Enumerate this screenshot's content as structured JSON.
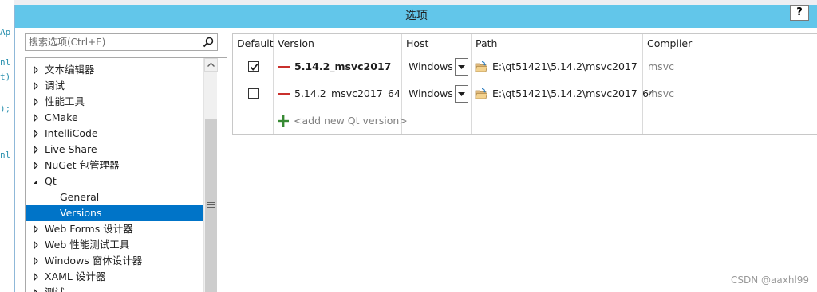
{
  "background": {
    "top_left_text": "...",
    "top_right_text": "",
    "code_fragments": [
      "Ap",
      "nl",
      "t)",
      ");",
      "nl"
    ]
  },
  "dialog": {
    "title": "选项",
    "help_label": "?"
  },
  "search": {
    "placeholder": "搜索选项(Ctrl+E)"
  },
  "tree": {
    "items": [
      {
        "label": "文本编辑器",
        "expanded": false,
        "level": 0
      },
      {
        "label": "调试",
        "expanded": false,
        "level": 0
      },
      {
        "label": "性能工具",
        "expanded": false,
        "level": 0
      },
      {
        "label": "CMake",
        "expanded": false,
        "level": 0
      },
      {
        "label": "IntelliCode",
        "expanded": false,
        "level": 0
      },
      {
        "label": "Live Share",
        "expanded": false,
        "level": 0
      },
      {
        "label": "NuGet 包管理器",
        "expanded": false,
        "level": 0
      },
      {
        "label": "Qt",
        "expanded": true,
        "level": 0
      },
      {
        "label": "General",
        "level": 1
      },
      {
        "label": "Versions",
        "level": 1,
        "selected": true
      },
      {
        "label": "Web Forms 设计器",
        "expanded": false,
        "level": 0
      },
      {
        "label": "Web 性能测试工具",
        "expanded": false,
        "level": 0
      },
      {
        "label": "Windows 窗体设计器",
        "expanded": false,
        "level": 0
      },
      {
        "label": "XAML 设计器",
        "expanded": false,
        "level": 0
      },
      {
        "label": "测试",
        "expanded": false,
        "level": 0
      }
    ]
  },
  "grid": {
    "headers": {
      "default": "Default",
      "version": "Version",
      "host": "Host",
      "path": "Path",
      "compiler": "Compiler"
    },
    "rows": [
      {
        "default": true,
        "version": "5.14.2_msvc2017",
        "host": "Windows",
        "path": "E:\\qt51421\\5.14.2\\msvc2017",
        "compiler": "msvc"
      },
      {
        "default": false,
        "version": "5.14.2_msvc2017_64",
        "host": "Windows",
        "path": "E:\\qt51421\\5.14.2\\msvc2017_64",
        "compiler": "msvc"
      }
    ],
    "add_label": "<add new Qt version>"
  },
  "colors": {
    "titlebar": "#62c6ea",
    "selection": "#0074c8",
    "remove_dash": "#c9302c",
    "add_plus": "#388a34"
  },
  "icons": {
    "search": "search-icon",
    "remove": "minus-icon",
    "add": "plus-icon",
    "folder": "folder-icon",
    "dropdown": "chevron-down-icon"
  },
  "watermark": "CSDN @aaxhl99"
}
